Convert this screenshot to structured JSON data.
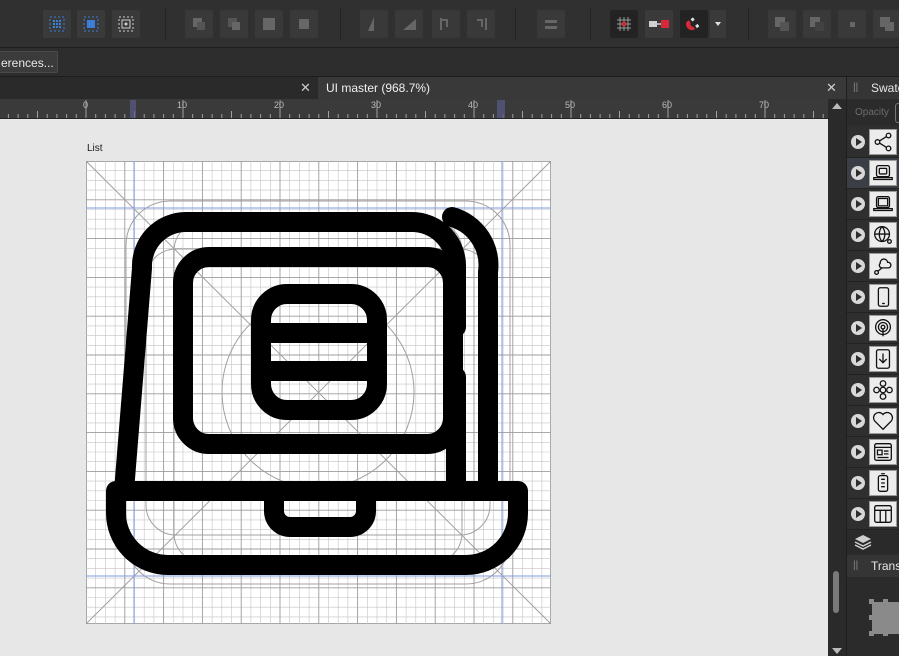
{
  "toolbar": {
    "groups": [
      {
        "icons": [
          "select-grid-icon",
          "snap-bounds-icon",
          "transform-origin-icon"
        ]
      },
      {
        "icons": [
          "arrange-front-icon",
          "arrange-forward-icon",
          "arrange-backward-icon",
          "arrange-back-icon"
        ]
      },
      {
        "icons": [
          "align-left-icon",
          "align-center-icon",
          "flip-horizontal-icon",
          "flip-vertical-icon"
        ]
      },
      {
        "icons": [
          "distribute-icon"
        ]
      },
      {
        "icons": [
          "pixel-grid-icon",
          "snap-to-pixel-icon",
          "snapping-magnet-icon",
          "snapping-dropdown-icon"
        ]
      },
      {
        "icons": [
          "boolean-add-icon",
          "boolean-subtract-icon",
          "boolean-intersect-icon",
          "boolean-xor-icon"
        ]
      }
    ]
  },
  "context": {
    "preferences_label": "erences..."
  },
  "tabs": [
    {
      "label": "",
      "active": false
    },
    {
      "label": "UI master (968.7%)",
      "active": true
    }
  ],
  "ruler": {
    "labels": [
      "0",
      "10",
      "20",
      "30",
      "40",
      "50",
      "60",
      "70"
    ]
  },
  "canvas": {
    "artboard_label": "List",
    "icon_name": "laptop-list-icon"
  },
  "panels": {
    "swatches_title": "Swatc",
    "opacity_label": "Opacity",
    "transform_title": "Transf"
  },
  "layers": [
    {
      "icon": "share-nodes-icon",
      "selected": false
    },
    {
      "icon": "laptop-list-icon",
      "selected": true
    },
    {
      "icon": "laptop-icon",
      "selected": false
    },
    {
      "icon": "globe-network-icon",
      "selected": false
    },
    {
      "icon": "cloud-share-icon",
      "selected": false
    },
    {
      "icon": "tablet-icon",
      "selected": false
    },
    {
      "icon": "broadcast-icon",
      "selected": false
    },
    {
      "icon": "download-icon",
      "selected": false
    },
    {
      "icon": "flower-icon",
      "selected": false
    },
    {
      "icon": "heart-icon",
      "selected": false
    },
    {
      "icon": "browser-window-icon",
      "selected": false
    },
    {
      "icon": "battery-icon",
      "selected": false
    },
    {
      "icon": "table-layout-icon",
      "selected": false
    }
  ],
  "colors": {
    "accent_blue": "#3b7fd6",
    "magnet_red": "#d8293a",
    "canvas_bg": "#e7e7e7"
  }
}
